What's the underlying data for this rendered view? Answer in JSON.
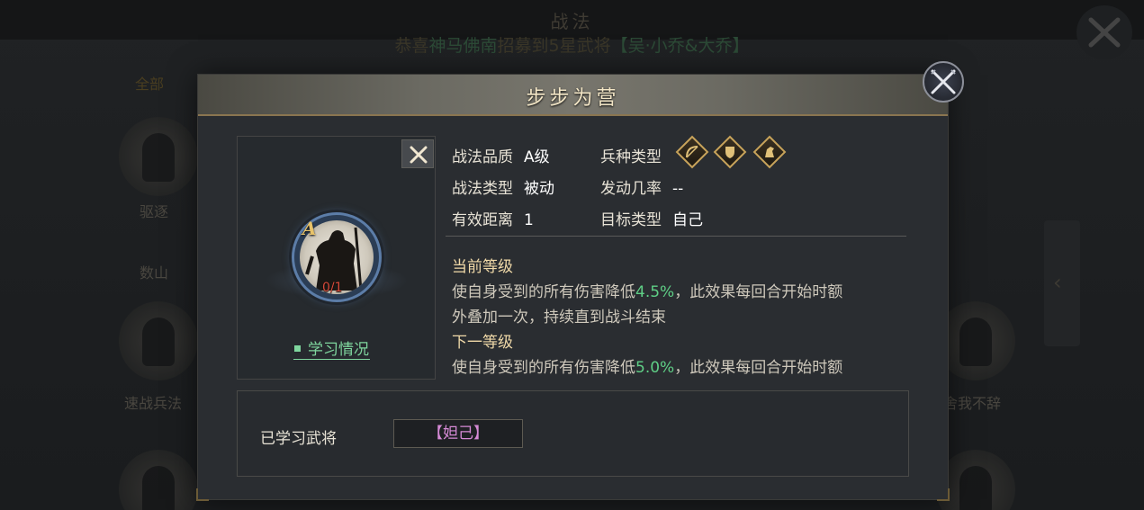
{
  "background": {
    "title": "战法",
    "ticker": {
      "prefix": "恭喜",
      "player": "神马佛南",
      "middle": "招募到5星武将",
      "hero": "【吴·小乔&大乔】"
    },
    "left_tab": "全部",
    "cards": [
      "驱逐",
      "数山",
      "速战兵法"
    ],
    "right_card": "舍我不辞"
  },
  "dialog": {
    "title": "步步为营",
    "attributes": {
      "quality_label": "战法品质",
      "quality_value": "A级",
      "type_label": "战法类型",
      "type_value": "被动",
      "range_label": "有效距离",
      "range_value": "1",
      "troop_label": "兵种类型",
      "troop_icons": [
        "archer-icon",
        "shield-icon",
        "cavalry-icon"
      ],
      "chance_label": "发动几率",
      "chance_value": "--",
      "target_label": "目标类型",
      "target_value": "自己"
    },
    "portrait": {
      "grade": "A",
      "count": "0/1",
      "study_link": "学习情况"
    },
    "current_level": {
      "title": "当前等级",
      "line1_pre": "使自身受到的所有伤害降低",
      "line1_value": "4.5%",
      "line1_post": "，此效果每回合开始时额",
      "line2": "外叠加一次，持续直到战斗结束"
    },
    "next_level": {
      "title": "下一等级",
      "line1_pre": "使自身受到的所有伤害降低",
      "line1_value": "5.0%",
      "line1_post": "，此效果每回合开始时额"
    },
    "learned": {
      "label": "已学习武将",
      "generals": [
        "【妲己】"
      ]
    }
  },
  "colors": {
    "highlight_green": "#5fcf86",
    "gold": "#c8a35a",
    "general_pink": "#d68ad6"
  }
}
